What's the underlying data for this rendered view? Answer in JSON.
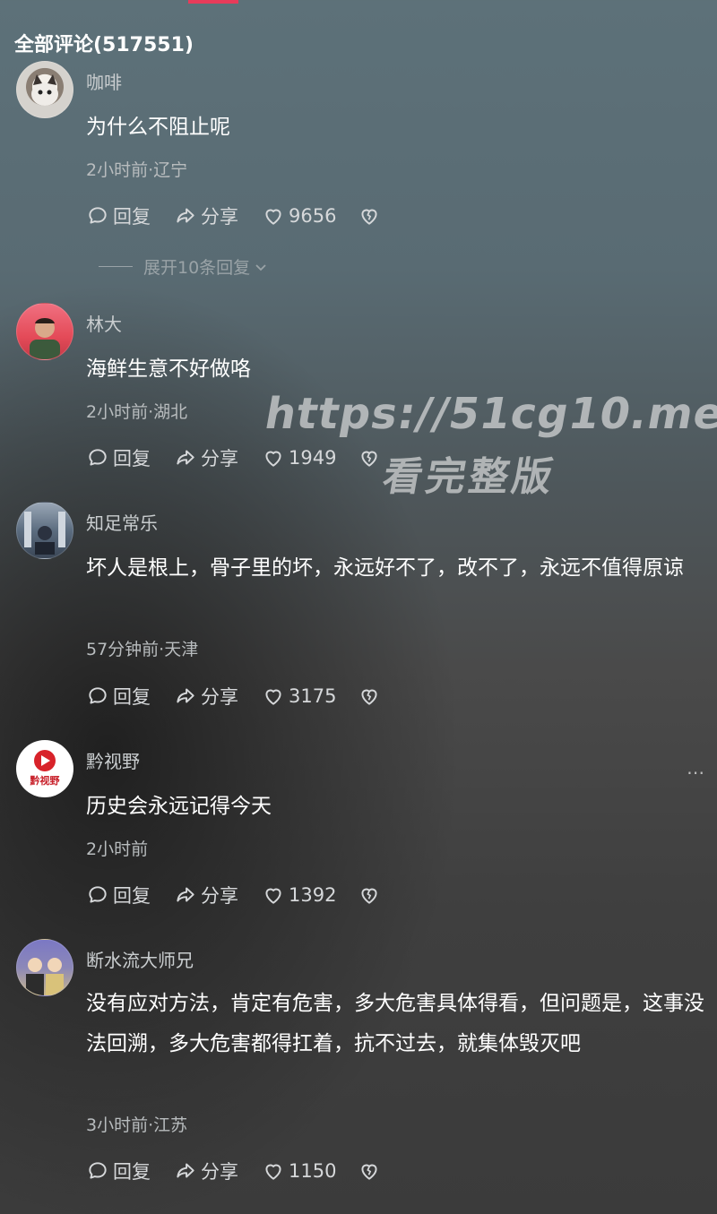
{
  "header": {
    "title": "全部评论(517551)"
  },
  "actions": {
    "reply": "回复",
    "share": "分享"
  },
  "comments": [
    {
      "username": "咖啡",
      "text": "为什么不阻止呢",
      "meta": "2小时前·辽宁",
      "likes": "9656",
      "avatar_color": "#c9c6c2"
    },
    {
      "username": "林大",
      "text": "海鲜生意不好做咯",
      "meta": "2小时前·湖北",
      "likes": "1949",
      "avatar_color": "#e44a58"
    },
    {
      "username": "知足常乐",
      "text": "坏人是根上，骨子里的坏，永远好不了，改不了，永远不值得原谅",
      "meta": "57分钟前·天津",
      "likes": "3175",
      "avatar_color": "#6b7c8f"
    },
    {
      "username": "黔视野",
      "text": "历史会永远记得今天",
      "meta": "2小时前",
      "likes": "1392",
      "avatar_color": "#ffffff"
    },
    {
      "username": "断水流大师兄",
      "text": "没有应对方法，肯定有危害，多大危害具体得看，但问题是，这事没法回溯，多大危害都得扛着，抗不过去，就集体毁灭吧",
      "meta": "3小时前·江苏",
      "likes": "1150",
      "avatar_color": "#6a6aa8"
    }
  ],
  "expand_replies": "展开10条回复",
  "more_icon": "⋯",
  "watermark": {
    "url": "https://51cg10.me",
    "sub": "看完整版"
  },
  "avatar_logo_text": "黔视野"
}
